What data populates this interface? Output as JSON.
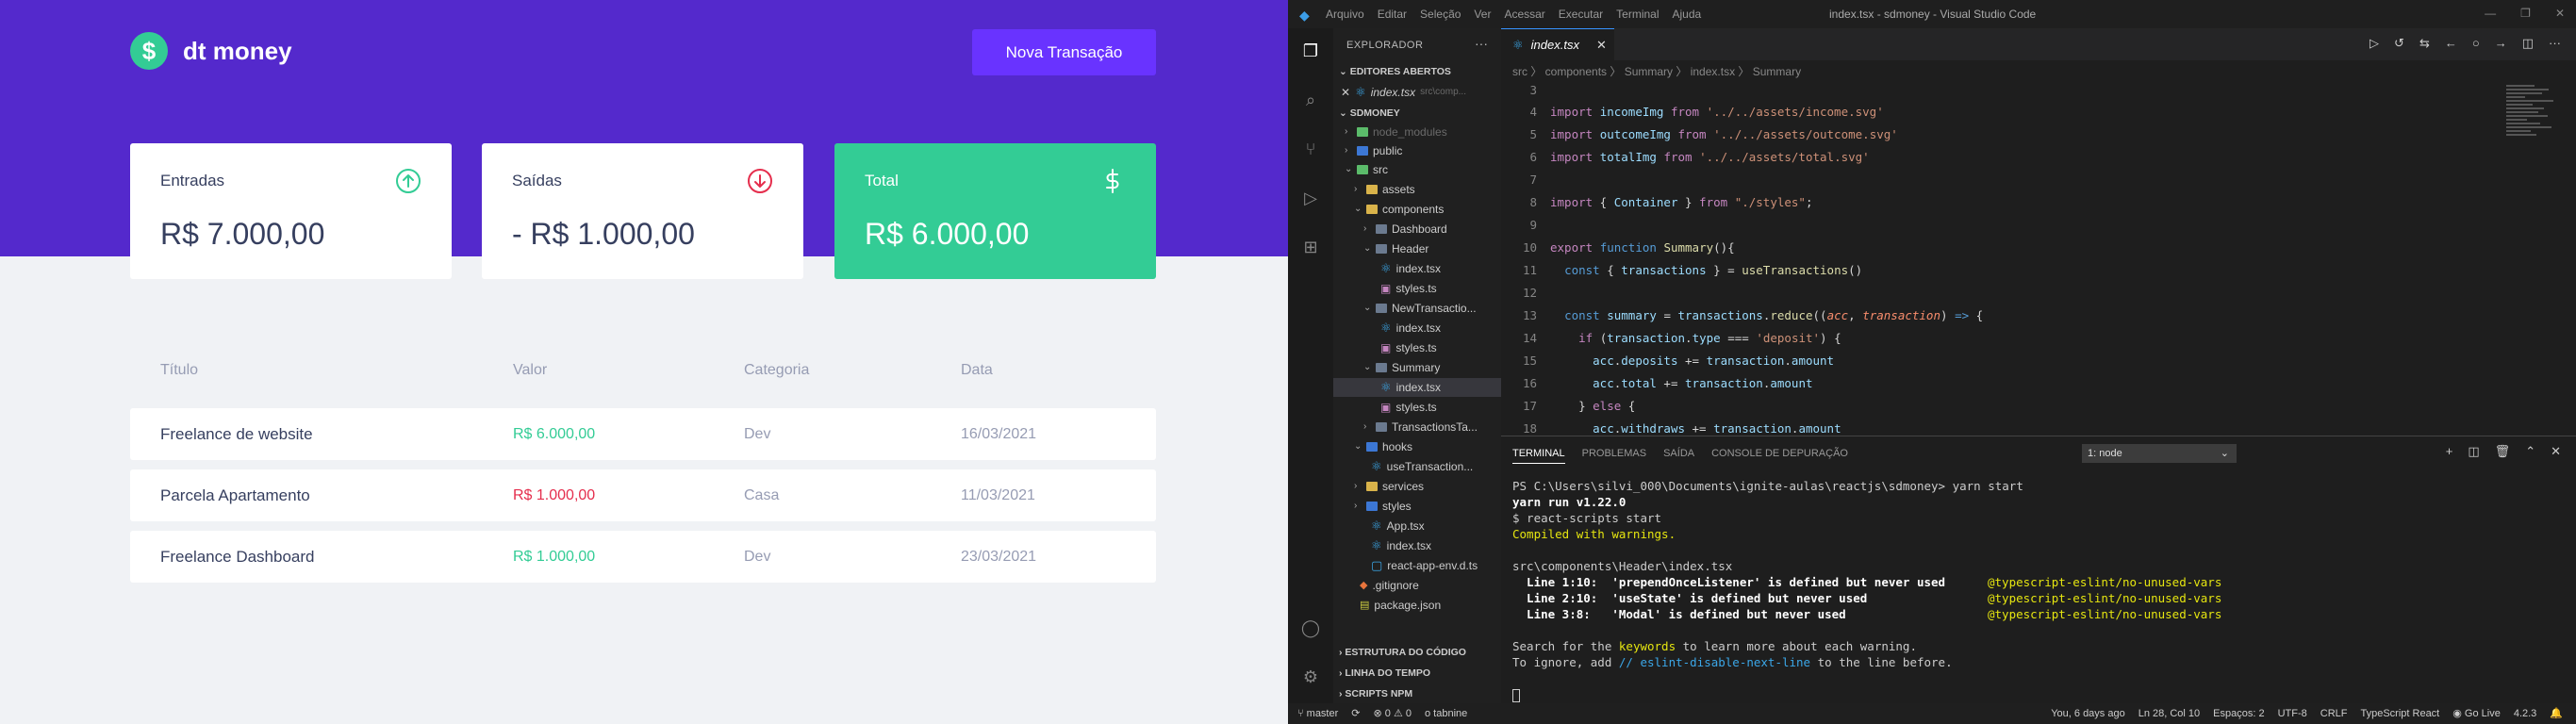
{
  "app": {
    "logo_symbol": "$",
    "logo_text": "dt money",
    "new_button": "Nova Transação",
    "cards": [
      {
        "label": "Entradas",
        "value": "R$ 7.000,00",
        "icon": "arrow-up-circle-icon"
      },
      {
        "label": "Saídas",
        "value": "- R$ 1.000,00",
        "icon": "arrow-down-circle-icon"
      },
      {
        "label": "Total",
        "value": "R$ 6.000,00",
        "icon": "dollar-icon"
      }
    ],
    "table_headers": [
      "Título",
      "Valor",
      "Categoria",
      "Data"
    ],
    "rows": [
      {
        "title": "Freelance de website",
        "value": "R$ 6.000,00",
        "type": "deposit",
        "category": "Dev",
        "date": "16/03/2021"
      },
      {
        "title": "Parcela Apartamento",
        "value": "R$ 1.000,00",
        "type": "withdraw",
        "category": "Casa",
        "date": "11/03/2021"
      },
      {
        "title": "Freelance Dashboard",
        "value": "R$ 1.000,00",
        "type": "deposit",
        "category": "Dev",
        "date": "23/03/2021"
      }
    ],
    "colors": {
      "brand": "#5429cc",
      "button": "#6933ff",
      "green": "#33cc95",
      "red": "#e52e4d",
      "background": "#f0f2f5"
    }
  },
  "vscode": {
    "menu": [
      "Arquivo",
      "Editar",
      "Seleção",
      "Ver",
      "Acessar",
      "Executar",
      "Terminal",
      "Ajuda"
    ],
    "window_title": "index.tsx - sdmoney - Visual Studio Code",
    "explorer": {
      "title": "EXPLORADOR",
      "open_editors": "EDITORES ABERTOS",
      "open_file": "index.tsx",
      "open_file_path": "src\\comp...",
      "root": "SDMONEY",
      "tree": {
        "node_modules": "node_modules",
        "public": "public",
        "src": "src",
        "assets": "assets",
        "components": "components",
        "dashboard": "Dashboard",
        "header": "Header",
        "index_tsx": "index.tsx",
        "styles_ts": "styles.ts",
        "new_transaction": "NewTransactio...",
        "summary": "Summary",
        "transactions_table": "TransactionsTa...",
        "hooks": "hooks",
        "use_transactions": "useTransaction...",
        "services": "services",
        "styles": "styles",
        "app_tsx": "App.tsx",
        "react_app_env": "react-app-env.d.ts",
        "gitignore": ".gitignore",
        "package_json": "package.json"
      },
      "sections": [
        "ESTRUTURA DO CÓDIGO",
        "LINHA DO TEMPO",
        "SCRIPTS NPM"
      ]
    },
    "tab": {
      "label": "index.tsx",
      "close": "✕"
    },
    "breadcrumb": "src  〉 components  〉 Summary  〉  index.tsx  〉  Summary",
    "line_numbers": [
      "3",
      "4",
      "5",
      "6",
      "7",
      "8",
      "9",
      "10",
      "11",
      "12",
      "13",
      "14",
      "15",
      "16",
      "17",
      "18"
    ],
    "panel": {
      "tabs": [
        "TERMINAL",
        "PROBLEMAS",
        "SAÍDA",
        "CONSOLE DE DEPURAÇÃO"
      ],
      "select": "1: node",
      "lines": {
        "prompt": "PS C:\\Users\\silvi_000\\Documents\\ignite-aulas\\reactjs\\sdmoney> yarn start",
        "yarn": "yarn run v1.22.0",
        "react": "$ react-scripts start",
        "compiled": "Compiled with warnings.",
        "file": "src\\components\\Header\\index.tsx",
        "w1": "  Line 1:10:  'prependOnceListener' is defined but never used",
        "w2": "  Line 2:10:  'useState' is defined but never used",
        "w3": "  Line 3:8:   'Modal' is defined but never used",
        "rule": "@typescript-eslint/no-unused-vars",
        "search_a": "Search for the ",
        "search_kw": "keywords",
        "search_b": " to learn more about each warning.",
        "ignore_a": "To ignore, add ",
        "ignore_kw": "// eslint-disable-next-line",
        "ignore_b": " to the line before."
      }
    },
    "status": {
      "branch": "master",
      "sync": "⟳",
      "problems": "⊗ 0 ⚠ 0",
      "tabnine": "o tabnine",
      "blame": "You, 6 days ago",
      "position": "Ln 28, Col 10",
      "spaces": "Espaços: 2",
      "encoding": "UTF-8",
      "eol": "CRLF",
      "language": "TypeScript React",
      "golive": "Go Live",
      "version": "4.2.3"
    }
  }
}
